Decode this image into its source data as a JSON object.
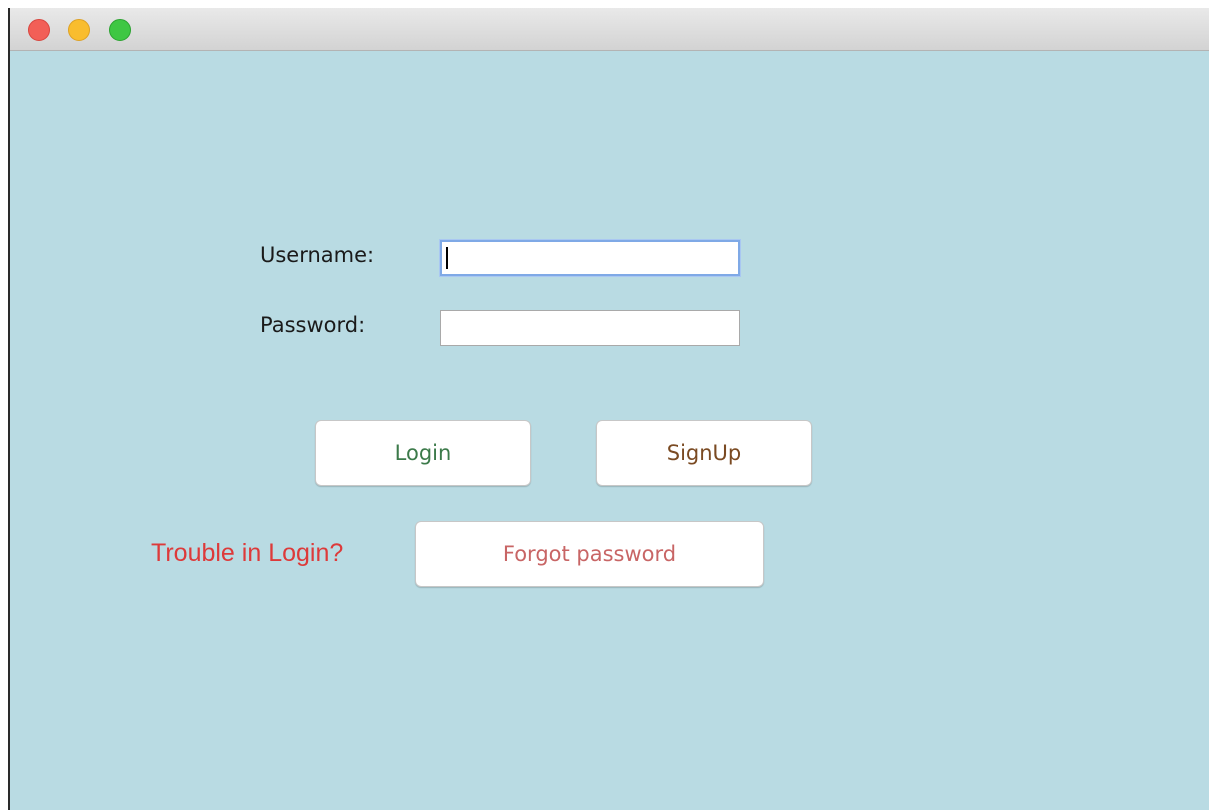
{
  "window": {
    "controls": [
      "close",
      "minimize",
      "zoom"
    ]
  },
  "form": {
    "username_label": "Username:",
    "username_value": "",
    "password_label": "Password:",
    "password_value": ""
  },
  "buttons": {
    "login_label": "Login",
    "signup_label": "SignUp",
    "forgot_label": "Forgot password"
  },
  "help": {
    "trouble_text": "Trouble in Login?"
  },
  "colors": {
    "background": "#b9dbe3",
    "login_text": "#3c7a4a",
    "signup_text": "#7a4a22",
    "forgot_text": "#c86565",
    "trouble_text": "#dd3a3a"
  }
}
